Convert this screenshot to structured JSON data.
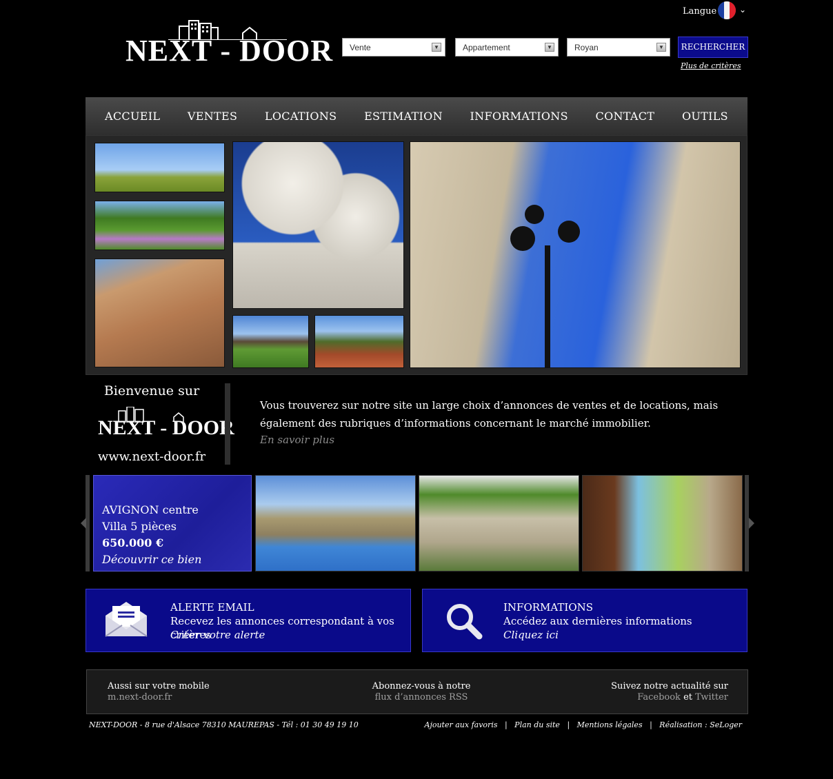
{
  "header": {
    "language_label": "Langue",
    "logo_text": "NEXT - DOOR",
    "search": {
      "transaction": "Vente",
      "property_type": "Appartement",
      "city": "Royan",
      "button_label": "RECHERCHER",
      "more_criteria": "Plus de critères"
    }
  },
  "nav": {
    "items": [
      "ACCUEIL",
      "VENTES",
      "LOCATIONS",
      "ESTIMATION",
      "INFORMATIONS",
      "CONTACT",
      "OUTILS"
    ]
  },
  "welcome": {
    "title": "Bienvenue sur",
    "url": "www.next-door.fr",
    "text": "Vous trouverez sur notre site un large choix d’annonces de ventes et de locations, mais également des rubriques d’informations concernant le marché immobilier.",
    "more": "En savoir plus"
  },
  "featured": {
    "city": "AVIGNON centre",
    "type": "Villa 5 pièces",
    "price": "650.000 €",
    "cta": "Découvrir ce bien"
  },
  "boxes": {
    "alert": {
      "title": "ALERTE EMAIL",
      "text": "Recevez les annonces correspondant à vos critères",
      "cta": "Créer votre alerte"
    },
    "info": {
      "title": "INFORMATIONS",
      "text": "Accédez aux dernières informations",
      "cta": "Cliquez ici"
    }
  },
  "footer": {
    "mobile_title": "Aussi sur votre mobile",
    "mobile_link": "m.next-door.fr",
    "rss_title": "Abonnez-vous à notre",
    "rss_link": "flux d’annonces RSS",
    "social_title": "Suivez notre actualité sur",
    "facebook": "Facebook",
    "and": "et",
    "twitter": "Twitter",
    "address": "NEXT-DOOR - 8 rue d'Alsace 78310 MAUREPAS - Tél : 01 30 49 19 10",
    "links": [
      "Ajouter aux favoris",
      "Plan du site",
      "Mentions légales"
    ],
    "credit": "Réalisation : SeLoger"
  },
  "colors": {
    "accent_blue": "#0a0a8a",
    "nav_gray": "#3c3c3c",
    "background": "#000000"
  }
}
